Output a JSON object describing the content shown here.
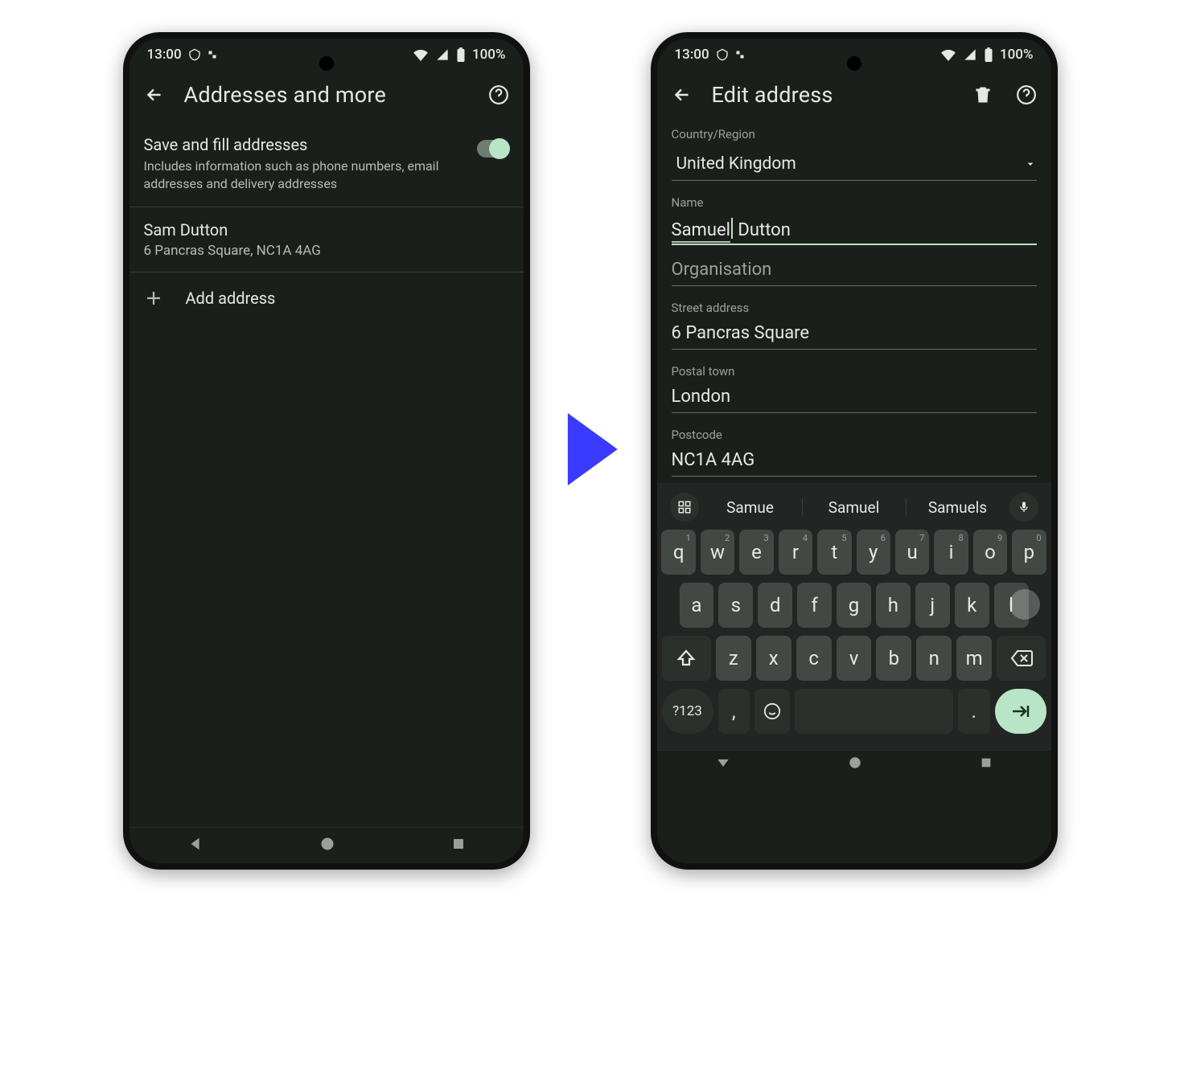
{
  "status": {
    "time": "13:00",
    "battery": "100%"
  },
  "left": {
    "title": "Addresses and more",
    "save_title": "Save and fill addresses",
    "save_sub": "Includes information such as phone numbers, email addresses and delivery addresses",
    "entry_name": "Sam Dutton",
    "entry_addr": "6 Pancras Square, NC1A 4AG",
    "add_label": "Add address"
  },
  "right": {
    "title": "Edit address",
    "country_label": "Country/Region",
    "country_value": "United Kingdom",
    "name_label": "Name",
    "name_first_word": "Samuel",
    "name_rest": " Dutton",
    "org_label": "Organisation",
    "street_label": "Street address",
    "street_value": "6 Pancras Square",
    "town_label": "Postal town",
    "town_value": "London",
    "postcode_label": "Postcode",
    "postcode_value": "NC1A 4AG",
    "suggestions": [
      "Samue",
      "Samuel",
      "Samuels"
    ],
    "row1": [
      {
        "k": "q",
        "s": "1"
      },
      {
        "k": "w",
        "s": "2"
      },
      {
        "k": "e",
        "s": "3"
      },
      {
        "k": "r",
        "s": "4"
      },
      {
        "k": "t",
        "s": "5"
      },
      {
        "k": "y",
        "s": "6"
      },
      {
        "k": "u",
        "s": "7"
      },
      {
        "k": "i",
        "s": "8"
      },
      {
        "k": "o",
        "s": "9"
      },
      {
        "k": "p",
        "s": "0"
      }
    ],
    "row2": [
      "a",
      "s",
      "d",
      "f",
      "g",
      "h",
      "j",
      "k",
      "l"
    ],
    "row3": [
      "z",
      "x",
      "c",
      "v",
      "b",
      "n",
      "m"
    ],
    "numkey": "?123",
    "comma": ",",
    "period": "."
  }
}
